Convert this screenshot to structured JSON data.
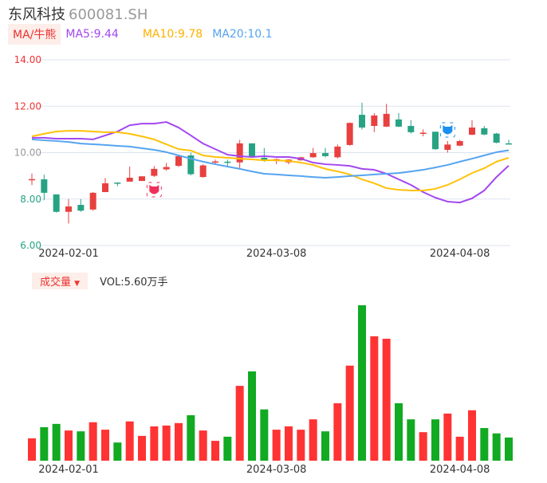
{
  "header": {
    "name": "东风科技",
    "code": "600081.SH"
  },
  "ma_bar": {
    "tag": "MA/牛熊",
    "ma5": "MA5:9.44",
    "ma10": "MA10:9.78",
    "ma20": "MA20:10.1"
  },
  "vol_bar": {
    "tag": "成交量",
    "arrow": "▼",
    "value": "VOL:5.60万手"
  },
  "colors": {
    "up": "#e84040",
    "down": "#27a383",
    "vol_up": "#ff3333",
    "vol_down": "#11aa22",
    "ma5": "#a347f0",
    "ma10": "#ffc107",
    "ma20": "#55a4f0"
  },
  "icons": {
    "bull": "bull-signal-icon",
    "bear": "bear-signal-icon"
  },
  "chart_data": {
    "type": "candlestick",
    "ylim": [
      6,
      14
    ],
    "yticks": [
      "14.00",
      "12.00",
      "10.00",
      "8.00",
      "6.00"
    ],
    "ytick_values": [
      14,
      12,
      10,
      8,
      6
    ],
    "xlabels": [
      {
        "index": 3,
        "label": "2024-02-01"
      },
      {
        "index": 20,
        "label": "2024-03-08"
      },
      {
        "index": 35,
        "label": "2024-04-08"
      }
    ],
    "candles": [
      [
        8.85,
        8.86,
        9.1,
        8.6
      ],
      [
        8.85,
        8.27,
        9.05,
        7.95
      ],
      [
        8.2,
        7.45,
        8.2,
        7.42
      ],
      [
        7.45,
        7.68,
        8.0,
        6.95
      ],
      [
        7.75,
        7.5,
        8.0,
        7.45
      ],
      [
        7.55,
        8.27,
        8.3,
        7.5
      ],
      [
        8.3,
        8.68,
        8.9,
        8.3
      ],
      [
        8.71,
        8.69,
        8.72,
        8.55
      ],
      [
        8.75,
        8.92,
        9.4,
        8.75
      ],
      [
        8.78,
        8.98,
        8.98,
        8.78
      ],
      [
        9.0,
        9.3,
        9.42,
        8.95
      ],
      [
        9.28,
        9.38,
        9.55,
        9.22
      ],
      [
        9.43,
        9.85,
        9.85,
        9.38
      ],
      [
        9.88,
        9.07,
        10.0,
        9.02
      ],
      [
        8.95,
        9.45,
        9.5,
        8.92
      ],
      [
        9.58,
        9.62,
        9.7,
        9.5
      ],
      [
        9.61,
        9.59,
        9.7,
        9.4
      ],
      [
        9.58,
        10.4,
        10.55,
        9.3
      ],
      [
        10.4,
        9.8,
        10.4,
        9.78
      ],
      [
        9.78,
        9.65,
        10.2,
        9.6
      ],
      [
        9.68,
        9.72,
        9.75,
        9.5
      ],
      [
        9.58,
        9.7,
        9.72,
        9.5
      ],
      [
        9.67,
        9.8,
        9.82,
        9.65
      ],
      [
        9.8,
        9.98,
        10.2,
        9.78
      ],
      [
        9.98,
        9.85,
        10.2,
        9.8
      ],
      [
        9.8,
        10.26,
        10.35,
        9.75
      ],
      [
        10.33,
        11.28,
        11.3,
        10.3
      ],
      [
        11.63,
        11.08,
        12.15,
        11.0
      ],
      [
        11.15,
        11.6,
        11.7,
        10.88
      ],
      [
        11.12,
        11.67,
        12.1,
        11.1
      ],
      [
        11.43,
        11.12,
        11.7,
        11.1
      ],
      [
        11.15,
        10.88,
        11.4,
        10.82
      ],
      [
        10.84,
        10.86,
        11.0,
        10.7
      ],
      [
        10.9,
        10.15,
        10.9,
        10.12
      ],
      [
        10.12,
        10.35,
        10.5,
        10.0
      ],
      [
        10.3,
        10.5,
        10.55,
        10.28
      ],
      [
        10.77,
        11.08,
        11.4,
        10.75
      ],
      [
        11.05,
        10.78,
        11.15,
        10.75
      ],
      [
        10.82,
        10.43,
        10.85,
        10.4
      ],
      [
        10.4,
        10.38,
        10.55,
        10.36
      ]
    ],
    "bull_signal_index": 10,
    "bear_signal_index": 34,
    "ma5": [
      10.64,
      10.64,
      10.6,
      10.6,
      10.6,
      10.57,
      10.74,
      10.91,
      11.18,
      11.25,
      11.25,
      11.32,
      11.08,
      10.74,
      10.39,
      10.15,
      9.91,
      9.85,
      9.81,
      9.85,
      9.81,
      9.81,
      9.74,
      9.57,
      9.5,
      9.47,
      9.43,
      9.3,
      9.26,
      9.09,
      8.85,
      8.61,
      8.3,
      8.06,
      7.89,
      7.85,
      8.03,
      8.37,
      8.95,
      9.44
    ],
    "ma10": [
      10.7,
      10.81,
      10.91,
      10.94,
      10.94,
      10.91,
      10.88,
      10.88,
      10.81,
      10.7,
      10.57,
      10.36,
      10.15,
      10.09,
      9.88,
      9.81,
      9.78,
      9.74,
      9.71,
      9.67,
      9.67,
      9.64,
      9.57,
      9.47,
      9.3,
      9.19,
      9.06,
      8.85,
      8.68,
      8.47,
      8.4,
      8.37,
      8.37,
      8.44,
      8.61,
      8.85,
      9.12,
      9.33,
      9.61,
      9.78
    ],
    "ma20": [
      10.57,
      10.53,
      10.5,
      10.46,
      10.39,
      10.36,
      10.33,
      10.29,
      10.26,
      10.19,
      10.12,
      10.02,
      9.88,
      9.74,
      9.61,
      9.5,
      9.4,
      9.3,
      9.19,
      9.09,
      9.06,
      9.02,
      8.99,
      8.95,
      8.92,
      8.95,
      8.99,
      9.02,
      9.06,
      9.09,
      9.12,
      9.19,
      9.26,
      9.36,
      9.47,
      9.61,
      9.74,
      9.88,
      10.02,
      10.1
    ],
    "volume_unit": "万手",
    "volume": [
      5.4,
      8.1,
      8.9,
      7.3,
      7.1,
      9.3,
      7.5,
      4.4,
      9.5,
      6.0,
      8.3,
      8.5,
      9.1,
      11.0,
      7.3,
      4.8,
      5.8,
      18.1,
      21.6,
      12.4,
      7.5,
      8.3,
      7.5,
      10.0,
      7.1,
      13.9,
      23.0,
      37.6,
      30.1,
      29.5,
      13.9,
      10.0,
      6.9,
      10.0,
      11.4,
      5.8,
      12.2,
      7.9,
      6.6,
      5.6
    ]
  }
}
